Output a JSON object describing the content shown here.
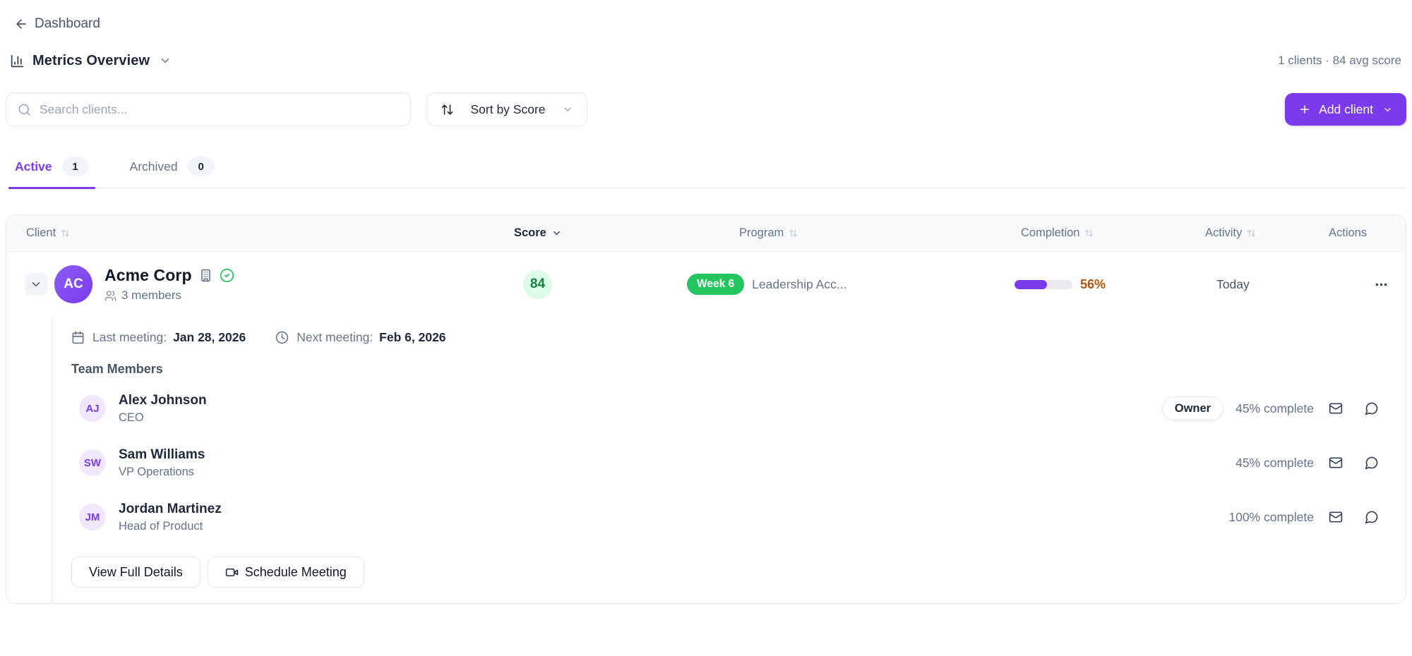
{
  "header": {
    "back_label": "Dashboard",
    "view_label": "Metrics Overview",
    "summary": "1 clients · 84 avg score"
  },
  "toolbar": {
    "search_placeholder": "Search clients...",
    "sort_label": "Sort by Score",
    "add_label": "Add client"
  },
  "tabs": {
    "active": {
      "label": "Active",
      "count": "1"
    },
    "archived": {
      "label": "Archived",
      "count": "0"
    }
  },
  "table": {
    "columns": {
      "client": "Client",
      "score": "Score",
      "program": "Program",
      "completion": "Completion",
      "activity": "Activity",
      "actions": "Actions"
    },
    "row": {
      "initials": "AC",
      "name": "Acme Corp",
      "members": "3 members",
      "score": "84",
      "week": "Week 6",
      "program": "Leadership Acc...",
      "completion_pct": 56,
      "completion": "56%",
      "activity": "Today"
    }
  },
  "details": {
    "last_label": "Last meeting:",
    "last_value": "Jan 28, 2026",
    "next_label": "Next meeting:",
    "next_value": "Feb 6, 2026",
    "team_title": "Team Members",
    "members": [
      {
        "initials": "AJ",
        "name": "Alex Johnson",
        "role": "CEO",
        "badge": "Owner",
        "progress": "45% complete"
      },
      {
        "initials": "SW",
        "name": "Sam Williams",
        "role": "VP Operations",
        "progress": "45% complete"
      },
      {
        "initials": "JM",
        "name": "Jordan Martinez",
        "role": "Head of Product",
        "progress": "100% complete"
      }
    ],
    "view_button": "View Full Details",
    "schedule_button": "Schedule Meeting"
  },
  "icons": [
    "arrow-left-icon",
    "bar-chart-icon",
    "chevron-down-icon",
    "search-icon",
    "sort-arrows-icon",
    "plus-icon",
    "building-icon",
    "verified-check-icon",
    "users-icon",
    "calendar-icon",
    "clock-icon",
    "mail-icon",
    "chat-bubble-icon",
    "video-camera-icon",
    "ellipsis-icon"
  ],
  "colors": {
    "accent": "#7c3aed",
    "accent_light": "#f1e8fd",
    "green": "#22c55e",
    "green_dark": "#15803d",
    "green_light": "#dcfce7",
    "amber": "#b45309",
    "text_dark": "#0f172a",
    "text_gray": "#64748b",
    "border": "#e5e7eb",
    "header_bg": "#f8fafc"
  }
}
